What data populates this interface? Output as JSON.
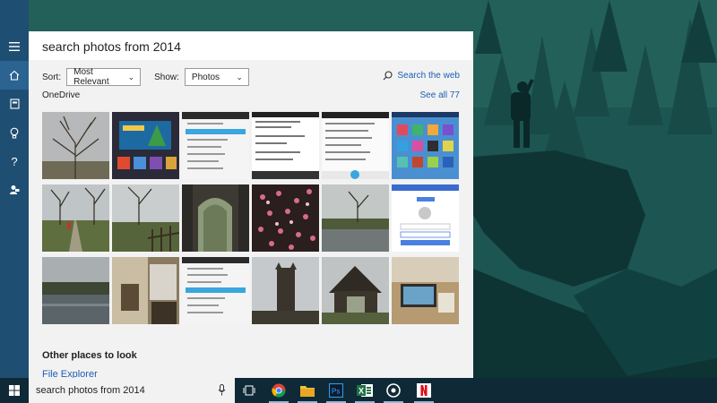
{
  "search": {
    "query": "search photos from 2014",
    "taskbar_query": "search photos from 2014"
  },
  "filters": {
    "sort_label": "Sort:",
    "sort_value": "Most Relevant",
    "show_label": "Show:",
    "show_value": "Photos",
    "web_link": "Search the web"
  },
  "results": {
    "section": "OneDrive",
    "see_all": "See all 77",
    "photos": [
      {
        "desc": "bare tree"
      },
      {
        "desc": "game screenshot"
      },
      {
        "desc": "system settings screenshot"
      },
      {
        "desc": "phone notifications screenshot"
      },
      {
        "desc": "email app screenshot"
      },
      {
        "desc": "phone home screen screenshot"
      },
      {
        "desc": "country lane"
      },
      {
        "desc": "field with fence"
      },
      {
        "desc": "stone gateway"
      },
      {
        "desc": "pink blossom"
      },
      {
        "desc": "pond with tree"
      },
      {
        "desc": "google sign in screenshot"
      },
      {
        "desc": "lake with trees"
      },
      {
        "desc": "window view"
      },
      {
        "desc": "security settings screenshot"
      },
      {
        "desc": "church tower"
      },
      {
        "desc": "lych gate"
      },
      {
        "desc": "desk with laptop"
      }
    ]
  },
  "other_places": {
    "heading": "Other places to look",
    "file_explorer": "File Explorer"
  },
  "taskbar": {
    "apps": [
      "task-view-icon",
      "chrome-icon",
      "file-explorer-icon",
      "photoshop-icon",
      "excel-icon",
      "groove-icon",
      "netflix-icon"
    ]
  },
  "colors": {
    "rail": "#1f4e73",
    "link": "#1a5fb4",
    "taskbar": "#0f2a36",
    "wallpaper": "#12403f"
  }
}
